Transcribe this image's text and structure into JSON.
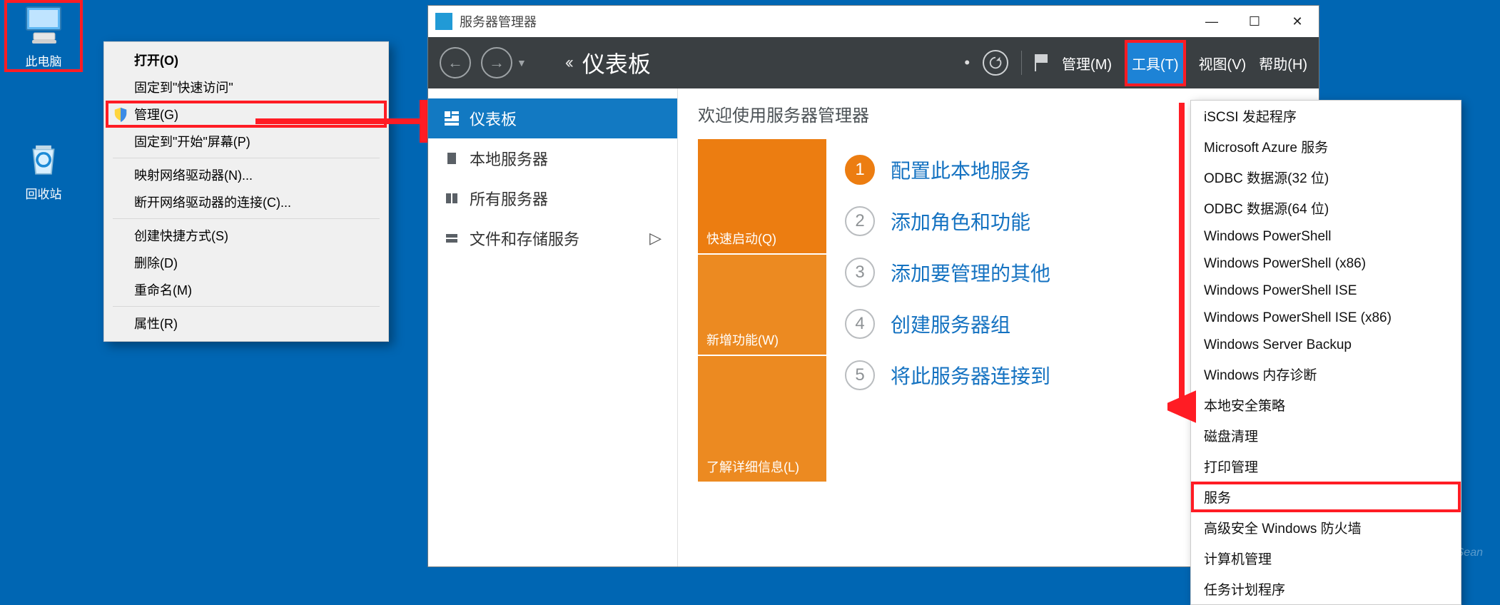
{
  "desktop": {
    "this_pc": "此电脑",
    "recycle_bin": "回收站"
  },
  "context_menu": {
    "items": [
      {
        "label": "打开(O)",
        "bold": true
      },
      {
        "label": "固定到\"快速访问\""
      },
      {
        "label": "管理(G)",
        "shield": true,
        "highlight": true
      },
      {
        "label": "固定到\"开始\"屏幕(P)"
      }
    ],
    "group2": [
      {
        "label": "映射网络驱动器(N)..."
      },
      {
        "label": "断开网络驱动器的连接(C)..."
      }
    ],
    "group3": [
      {
        "label": "创建快捷方式(S)"
      },
      {
        "label": "删除(D)"
      },
      {
        "label": "重命名(M)"
      }
    ],
    "group4": [
      {
        "label": "属性(R)"
      }
    ]
  },
  "server_manager": {
    "title": "服务器管理器",
    "breadcrumb": "仪表板",
    "menu": {
      "manage": "管理(M)",
      "tools": "工具(T)",
      "view": "视图(V)",
      "help": "帮助(H)"
    },
    "sidebar": {
      "items": [
        {
          "label": "仪表板",
          "active": true,
          "icon": "dashboard"
        },
        {
          "label": "本地服务器",
          "icon": "server"
        },
        {
          "label": "所有服务器",
          "icon": "servers"
        },
        {
          "label": "文件和存储服务",
          "icon": "storage",
          "chev": true
        }
      ]
    },
    "welcome": "欢迎使用服务器管理器",
    "tiles": {
      "quickstart": "快速启动(Q)",
      "whatsnew": "新增功能(W)",
      "learnmore": "了解详细信息(L)"
    },
    "steps": [
      {
        "n": "1",
        "label": "配置此本地服务",
        "primary": true
      },
      {
        "n": "2",
        "label": "添加角色和功能"
      },
      {
        "n": "3",
        "label": "添加要管理的其他"
      },
      {
        "n": "4",
        "label": "创建服务器组"
      },
      {
        "n": "5",
        "label": "将此服务器连接到"
      }
    ],
    "tools_menu": [
      "iSCSI 发起程序",
      "Microsoft Azure 服务",
      "ODBC 数据源(32 位)",
      "ODBC 数据源(64 位)",
      "Windows PowerShell",
      "Windows PowerShell (x86)",
      "Windows PowerShell ISE",
      "Windows PowerShell ISE (x86)",
      "Windows Server Backup",
      "Windows 内存诊断",
      "本地安全策略",
      "磁盘清理",
      "打印管理",
      "服务",
      "高级安全 Windows 防火墙",
      "计算机管理",
      "任务计划程序"
    ],
    "tools_highlight": "服务"
  },
  "watermark": "CSDN @Feng_Sean"
}
